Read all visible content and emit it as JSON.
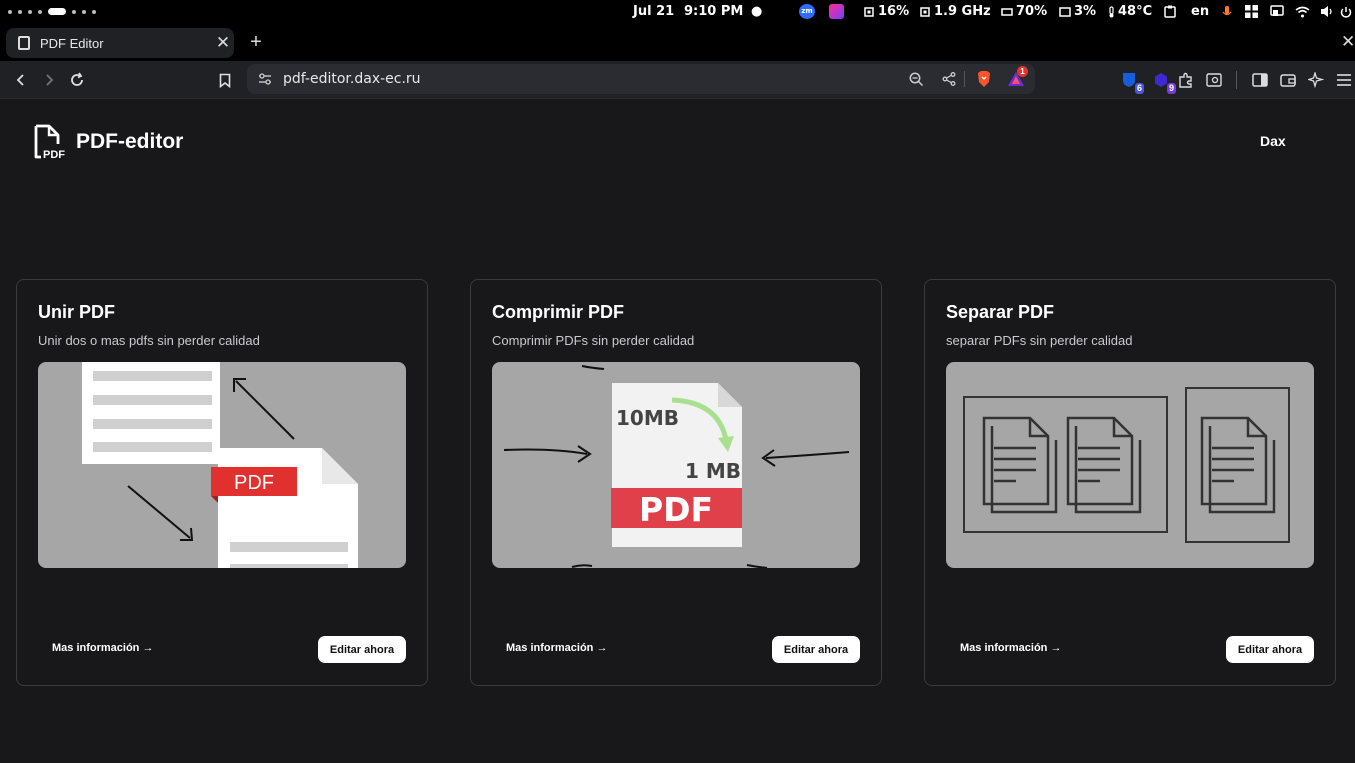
{
  "system_bar": {
    "date": "Jul 21",
    "time": "9:10 PM",
    "cpu": "16%",
    "freq": "1.9 GHz",
    "memory": "70%",
    "disk": "3%",
    "temperature": "48°C",
    "language": "en"
  },
  "browser": {
    "tab_title": "PDF Editor",
    "url": "pdf-editor.dax-ec.ru",
    "brave_shield_badge": "1",
    "ext_badge_1": "6",
    "ext_badge_2": "9"
  },
  "header": {
    "brand": "PDF-editor",
    "user": "Dax"
  },
  "cards": [
    {
      "title": "Unir PDF",
      "description": "Unir dos o mas pdfs sin perder calidad",
      "image_label": "PDF",
      "more": "Mas información →",
      "action": "Editar ahora"
    },
    {
      "title": "Comprimir PDF",
      "description": "Comprimir PDFs sin perder calidad",
      "image_label": "PDF",
      "image_size_from": "10MB",
      "image_size_to": "1 MB",
      "more": "Mas información →",
      "action": "Editar ahora"
    },
    {
      "title": "Separar PDF",
      "description": "separar PDFs sin perder calidad",
      "more": "Mas información →",
      "action": "Editar ahora"
    }
  ],
  "colors": {
    "background": "#18181b",
    "card_border": "#3a3a40",
    "image_bg": "#a6a6a6",
    "pdf_red": "#e0312f",
    "arrow_green": "#a8e090"
  }
}
